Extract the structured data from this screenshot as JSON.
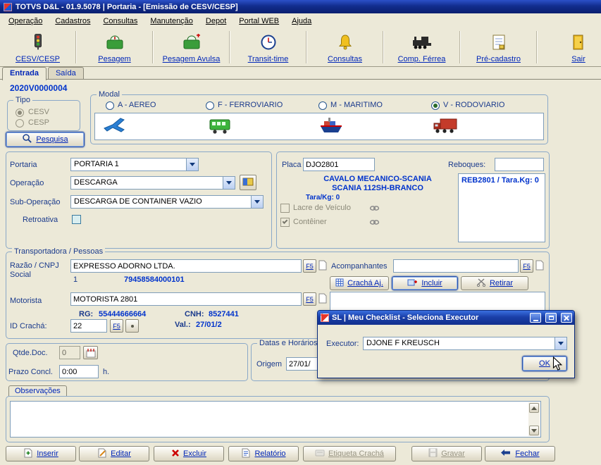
{
  "colors": {
    "titlebar_blue": "#122d8e",
    "background": "#ece9d8",
    "accent_navy": "#0026b8",
    "value_blue": "#0033cc"
  },
  "window": {
    "title": "TOTVS D&L - 01.9.5078 | Portaria - [Emissão de CESV/CESP]"
  },
  "menu": {
    "items": [
      "Operação",
      "Cadastros",
      "Consultas",
      "Manutenção",
      "Depot",
      "Portal WEB",
      "Ajuda"
    ]
  },
  "toolbar": {
    "items": [
      {
        "label": "CESV/CESP",
        "icon": "traffic-light"
      },
      {
        "label": "Pesagem",
        "icon": "scale"
      },
      {
        "label": "Pesagem Avulsa",
        "icon": "scale-plus"
      },
      {
        "label": "Transit-time",
        "icon": "clock"
      },
      {
        "label": "Consultas",
        "icon": "bell"
      },
      {
        "label": "Comp. Férrea",
        "icon": "locomotive"
      },
      {
        "label": "Pré-cadastro",
        "icon": "form-page"
      },
      {
        "label": "Sair",
        "icon": "exit-door"
      }
    ]
  },
  "tabs": {
    "items": [
      {
        "label": "Entrada",
        "active": true
      },
      {
        "label": "Saída",
        "active": false
      }
    ]
  },
  "form": {
    "doc_number": "2020V0000004",
    "tipo": {
      "legend": "Tipo",
      "options": [
        "CESV",
        "CESP"
      ],
      "selected": "CESV"
    },
    "modal": {
      "legend": "Modal",
      "options": [
        "A - AEREO",
        "F - FERROVIARIO",
        "M - MARITIMO",
        "V - RODOVIARIO"
      ],
      "selected": "V - RODOVIARIO"
    },
    "pesquisa_label": "Pesquisa",
    "portaria": {
      "label": "Portaria",
      "value": "PORTARIA 1"
    },
    "operacao": {
      "label": "Operação",
      "value": "DESCARGA"
    },
    "sub_operacao": {
      "label": "Sub-Operação",
      "value": "DESCARGA DE CONTAINER VAZIO"
    },
    "retroativa_label": "Retroativa",
    "vehicle": {
      "placa_label": "Placa",
      "placa_value": "DJO2801",
      "reboques_label": "Reboques:",
      "desc_line1": "CAVALO MECANICO-SCANIA",
      "desc_line2": "SCANIA 112SH-BRANCO",
      "tara": "Tara/Kg: 0",
      "reboque_item": "REB2801 / Tara.Kg: 0",
      "lacre_label": "Lacre de Veículo",
      "conteiner_label": "Contêiner"
    },
    "transportadora": {
      "legend": "Transportadora / Pessoas",
      "razao_label_line1": "Razão / CNPJ",
      "razao_label_line2": "Social",
      "razao_value": "EXPRESSO ADORNO LTDA.",
      "razao_seq": "1",
      "cnpj": "79458584000101",
      "f5_label": "F5",
      "acompanhantes_label": "Acompanhantes",
      "cracha_aj_label": "Crachá Aj.",
      "incluir_label": "Incluir",
      "retirar_label": "Retirar",
      "motorista_label": "Motorista",
      "motorista_value": "MOTORISTA 2801",
      "rg_label": "RG:",
      "rg_value": "55444666664",
      "cnh_label": "CNH:",
      "cnh_value": "8527441",
      "val_label": "Val.:",
      "val_value": "27/01/2",
      "id_cracha_label": "ID Crachá:",
      "id_cracha_value": "22"
    },
    "documentos": {
      "qtde_label": "Qtde.Doc.",
      "qtde_value": "0",
      "prazo_label": "Prazo Concl.",
      "prazo_value": "0:00",
      "prazo_suffix": "h."
    },
    "datas": {
      "legend": "Datas e Horários",
      "origem_label": "Origem",
      "origem_value": "27/01/"
    },
    "observacoes_label": "Observações"
  },
  "dialog": {
    "title": "SL | Meu Checklist - Seleciona Executor",
    "executor_label": "Executor:",
    "executor_value": "DJONE F KREUSCH",
    "ok_label": "OK"
  },
  "footer": {
    "buttons": [
      {
        "label": "Inserir",
        "disabled": false
      },
      {
        "label": "Editar",
        "disabled": false
      },
      {
        "label": "Excluir",
        "disabled": false
      },
      {
        "label": "Relatório",
        "disabled": false
      },
      {
        "label": "Etiqueta Crachá",
        "disabled": true
      },
      {
        "label": "Gravar",
        "disabled": true
      },
      {
        "label": "Fechar",
        "disabled": false
      }
    ]
  }
}
